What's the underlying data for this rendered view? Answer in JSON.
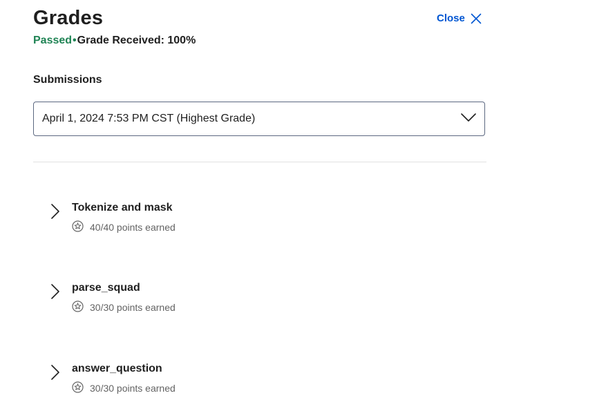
{
  "header": {
    "title": "Grades",
    "close_label": "Close"
  },
  "status": {
    "passed": "Passed",
    "separator": "•",
    "grade_text": "Grade Received: 100%"
  },
  "submissions": {
    "label": "Submissions",
    "selected": "April 1, 2024 7:53 PM CST (Highest Grade)"
  },
  "items": [
    {
      "title": "Tokenize and mask",
      "points": "40/40 points earned"
    },
    {
      "title": "parse_squad",
      "points": "30/30 points earned"
    },
    {
      "title": "answer_question",
      "points": "30/30 points earned"
    }
  ],
  "icons": {
    "close": "close-icon",
    "dropdown": "chevron-down-icon",
    "expand": "chevron-right-icon",
    "points": "star-badge-icon"
  },
  "colors": {
    "accent": "#0056d2",
    "passed": "#1f8354",
    "text": "#1f1f1f",
    "muted": "#636363",
    "border": "#5b6780"
  }
}
